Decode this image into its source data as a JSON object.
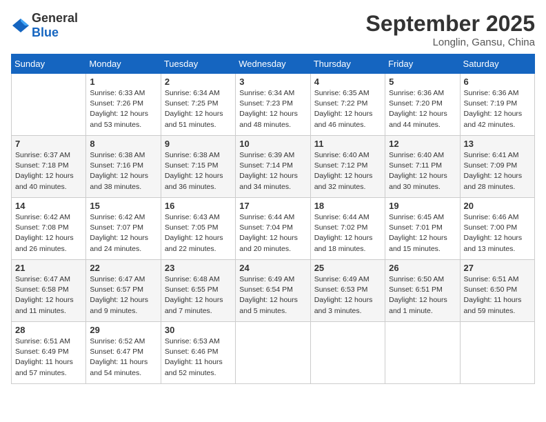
{
  "header": {
    "logo_general": "General",
    "logo_blue": "Blue",
    "month_title": "September 2025",
    "subtitle": "Longlin, Gansu, China"
  },
  "days_of_week": [
    "Sunday",
    "Monday",
    "Tuesday",
    "Wednesday",
    "Thursday",
    "Friday",
    "Saturday"
  ],
  "weeks": [
    [
      {
        "day": "",
        "sunrise": "",
        "sunset": "",
        "daylight": ""
      },
      {
        "day": "1",
        "sunrise": "Sunrise: 6:33 AM",
        "sunset": "Sunset: 7:26 PM",
        "daylight": "Daylight: 12 hours and 53 minutes."
      },
      {
        "day": "2",
        "sunrise": "Sunrise: 6:34 AM",
        "sunset": "Sunset: 7:25 PM",
        "daylight": "Daylight: 12 hours and 51 minutes."
      },
      {
        "day": "3",
        "sunrise": "Sunrise: 6:34 AM",
        "sunset": "Sunset: 7:23 PM",
        "daylight": "Daylight: 12 hours and 48 minutes."
      },
      {
        "day": "4",
        "sunrise": "Sunrise: 6:35 AM",
        "sunset": "Sunset: 7:22 PM",
        "daylight": "Daylight: 12 hours and 46 minutes."
      },
      {
        "day": "5",
        "sunrise": "Sunrise: 6:36 AM",
        "sunset": "Sunset: 7:20 PM",
        "daylight": "Daylight: 12 hours and 44 minutes."
      },
      {
        "day": "6",
        "sunrise": "Sunrise: 6:36 AM",
        "sunset": "Sunset: 7:19 PM",
        "daylight": "Daylight: 12 hours and 42 minutes."
      }
    ],
    [
      {
        "day": "7",
        "sunrise": "Sunrise: 6:37 AM",
        "sunset": "Sunset: 7:18 PM",
        "daylight": "Daylight: 12 hours and 40 minutes."
      },
      {
        "day": "8",
        "sunrise": "Sunrise: 6:38 AM",
        "sunset": "Sunset: 7:16 PM",
        "daylight": "Daylight: 12 hours and 38 minutes."
      },
      {
        "day": "9",
        "sunrise": "Sunrise: 6:38 AM",
        "sunset": "Sunset: 7:15 PM",
        "daylight": "Daylight: 12 hours and 36 minutes."
      },
      {
        "day": "10",
        "sunrise": "Sunrise: 6:39 AM",
        "sunset": "Sunset: 7:14 PM",
        "daylight": "Daylight: 12 hours and 34 minutes."
      },
      {
        "day": "11",
        "sunrise": "Sunrise: 6:40 AM",
        "sunset": "Sunset: 7:12 PM",
        "daylight": "Daylight: 12 hours and 32 minutes."
      },
      {
        "day": "12",
        "sunrise": "Sunrise: 6:40 AM",
        "sunset": "Sunset: 7:11 PM",
        "daylight": "Daylight: 12 hours and 30 minutes."
      },
      {
        "day": "13",
        "sunrise": "Sunrise: 6:41 AM",
        "sunset": "Sunset: 7:09 PM",
        "daylight": "Daylight: 12 hours and 28 minutes."
      }
    ],
    [
      {
        "day": "14",
        "sunrise": "Sunrise: 6:42 AM",
        "sunset": "Sunset: 7:08 PM",
        "daylight": "Daylight: 12 hours and 26 minutes."
      },
      {
        "day": "15",
        "sunrise": "Sunrise: 6:42 AM",
        "sunset": "Sunset: 7:07 PM",
        "daylight": "Daylight: 12 hours and 24 minutes."
      },
      {
        "day": "16",
        "sunrise": "Sunrise: 6:43 AM",
        "sunset": "Sunset: 7:05 PM",
        "daylight": "Daylight: 12 hours and 22 minutes."
      },
      {
        "day": "17",
        "sunrise": "Sunrise: 6:44 AM",
        "sunset": "Sunset: 7:04 PM",
        "daylight": "Daylight: 12 hours and 20 minutes."
      },
      {
        "day": "18",
        "sunrise": "Sunrise: 6:44 AM",
        "sunset": "Sunset: 7:02 PM",
        "daylight": "Daylight: 12 hours and 18 minutes."
      },
      {
        "day": "19",
        "sunrise": "Sunrise: 6:45 AM",
        "sunset": "Sunset: 7:01 PM",
        "daylight": "Daylight: 12 hours and 15 minutes."
      },
      {
        "day": "20",
        "sunrise": "Sunrise: 6:46 AM",
        "sunset": "Sunset: 7:00 PM",
        "daylight": "Daylight: 12 hours and 13 minutes."
      }
    ],
    [
      {
        "day": "21",
        "sunrise": "Sunrise: 6:47 AM",
        "sunset": "Sunset: 6:58 PM",
        "daylight": "Daylight: 12 hours and 11 minutes."
      },
      {
        "day": "22",
        "sunrise": "Sunrise: 6:47 AM",
        "sunset": "Sunset: 6:57 PM",
        "daylight": "Daylight: 12 hours and 9 minutes."
      },
      {
        "day": "23",
        "sunrise": "Sunrise: 6:48 AM",
        "sunset": "Sunset: 6:55 PM",
        "daylight": "Daylight: 12 hours and 7 minutes."
      },
      {
        "day": "24",
        "sunrise": "Sunrise: 6:49 AM",
        "sunset": "Sunset: 6:54 PM",
        "daylight": "Daylight: 12 hours and 5 minutes."
      },
      {
        "day": "25",
        "sunrise": "Sunrise: 6:49 AM",
        "sunset": "Sunset: 6:53 PM",
        "daylight": "Daylight: 12 hours and 3 minutes."
      },
      {
        "day": "26",
        "sunrise": "Sunrise: 6:50 AM",
        "sunset": "Sunset: 6:51 PM",
        "daylight": "Daylight: 12 hours and 1 minute."
      },
      {
        "day": "27",
        "sunrise": "Sunrise: 6:51 AM",
        "sunset": "Sunset: 6:50 PM",
        "daylight": "Daylight: 11 hours and 59 minutes."
      }
    ],
    [
      {
        "day": "28",
        "sunrise": "Sunrise: 6:51 AM",
        "sunset": "Sunset: 6:49 PM",
        "daylight": "Daylight: 11 hours and 57 minutes."
      },
      {
        "day": "29",
        "sunrise": "Sunrise: 6:52 AM",
        "sunset": "Sunset: 6:47 PM",
        "daylight": "Daylight: 11 hours and 54 minutes."
      },
      {
        "day": "30",
        "sunrise": "Sunrise: 6:53 AM",
        "sunset": "Sunset: 6:46 PM",
        "daylight": "Daylight: 11 hours and 52 minutes."
      },
      {
        "day": "",
        "sunrise": "",
        "sunset": "",
        "daylight": ""
      },
      {
        "day": "",
        "sunrise": "",
        "sunset": "",
        "daylight": ""
      },
      {
        "day": "",
        "sunrise": "",
        "sunset": "",
        "daylight": ""
      },
      {
        "day": "",
        "sunrise": "",
        "sunset": "",
        "daylight": ""
      }
    ]
  ]
}
